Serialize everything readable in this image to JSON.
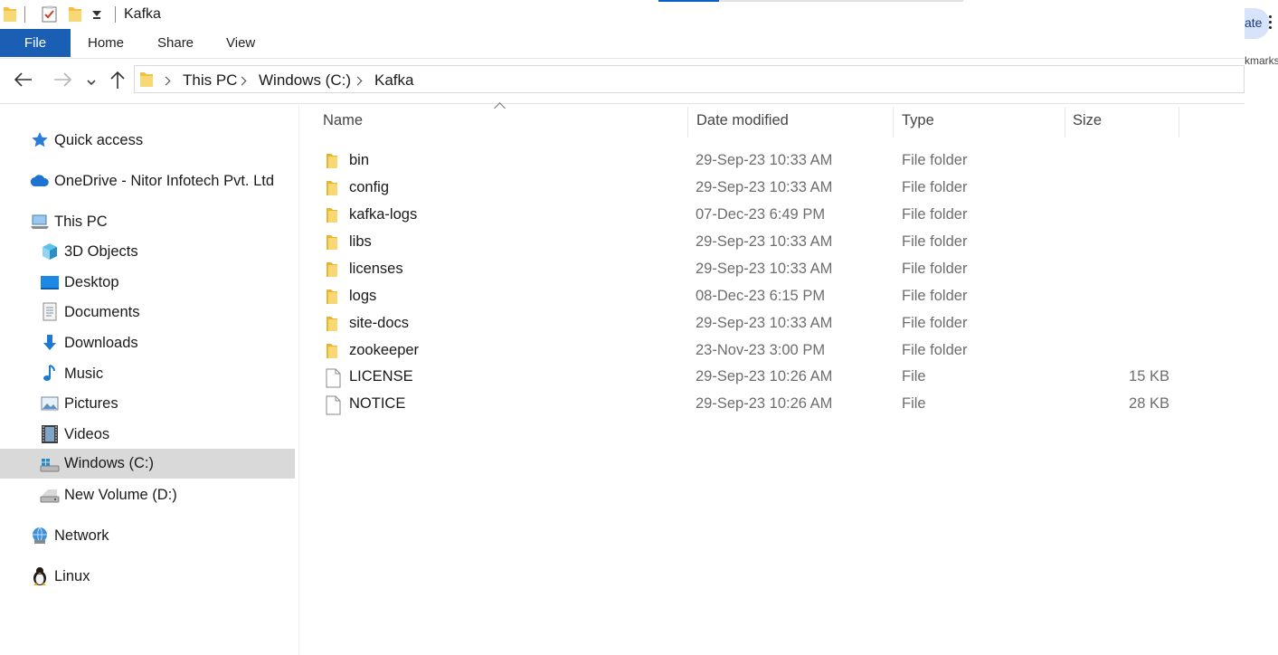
{
  "window": {
    "title": "Kafka"
  },
  "ribbon": {
    "tabs": [
      "File",
      "Home",
      "Share",
      "View"
    ]
  },
  "address": {
    "crumbs": [
      "This PC",
      "Windows (C:)",
      "Kafka"
    ]
  },
  "browser_edge": {
    "update_label": "ate",
    "bookmarks_label": "kmarks"
  },
  "nav": {
    "quick_access": "Quick access",
    "onedrive": "OneDrive - Nitor Infotech Pvt. Ltd",
    "this_pc": "This PC",
    "objects_3d": "3D Objects",
    "desktop": "Desktop",
    "documents": "Documents",
    "downloads": "Downloads",
    "music": "Music",
    "pictures": "Pictures",
    "videos": "Videos",
    "windows_c": "Windows (C:)",
    "new_volume": "New Volume (D:)",
    "network": "Network",
    "linux": "Linux"
  },
  "columns": {
    "name": "Name",
    "date": "Date modified",
    "type": "Type",
    "size": "Size"
  },
  "files": [
    {
      "name": "bin",
      "date": "29-Sep-23 10:33 AM",
      "type": "File folder",
      "size": "",
      "icon": "folder-icon"
    },
    {
      "name": "config",
      "date": "29-Sep-23 10:33 AM",
      "type": "File folder",
      "size": "",
      "icon": "folder-icon"
    },
    {
      "name": "kafka-logs",
      "date": "07-Dec-23 6:49 PM",
      "type": "File folder",
      "size": "",
      "icon": "folder-icon"
    },
    {
      "name": "libs",
      "date": "29-Sep-23 10:33 AM",
      "type": "File folder",
      "size": "",
      "icon": "folder-icon"
    },
    {
      "name": "licenses",
      "date": "29-Sep-23 10:33 AM",
      "type": "File folder",
      "size": "",
      "icon": "folder-icon"
    },
    {
      "name": "logs",
      "date": "08-Dec-23 6:15 PM",
      "type": "File folder",
      "size": "",
      "icon": "folder-icon"
    },
    {
      "name": "site-docs",
      "date": "29-Sep-23 10:33 AM",
      "type": "File folder",
      "size": "",
      "icon": "folder-icon"
    },
    {
      "name": "zookeeper",
      "date": "23-Nov-23 3:00 PM",
      "type": "File folder",
      "size": "",
      "icon": "folder-icon"
    },
    {
      "name": "LICENSE",
      "date": "29-Sep-23 10:26 AM",
      "type": "File",
      "size": "15 KB",
      "icon": "file-icon"
    },
    {
      "name": "NOTICE",
      "date": "29-Sep-23 10:26 AM",
      "type": "File",
      "size": "28 KB",
      "icon": "file-icon"
    }
  ],
  "colors": {
    "accent": "#1a5fb4",
    "selection": "#d9d9d9",
    "folder": "#f5c542"
  }
}
